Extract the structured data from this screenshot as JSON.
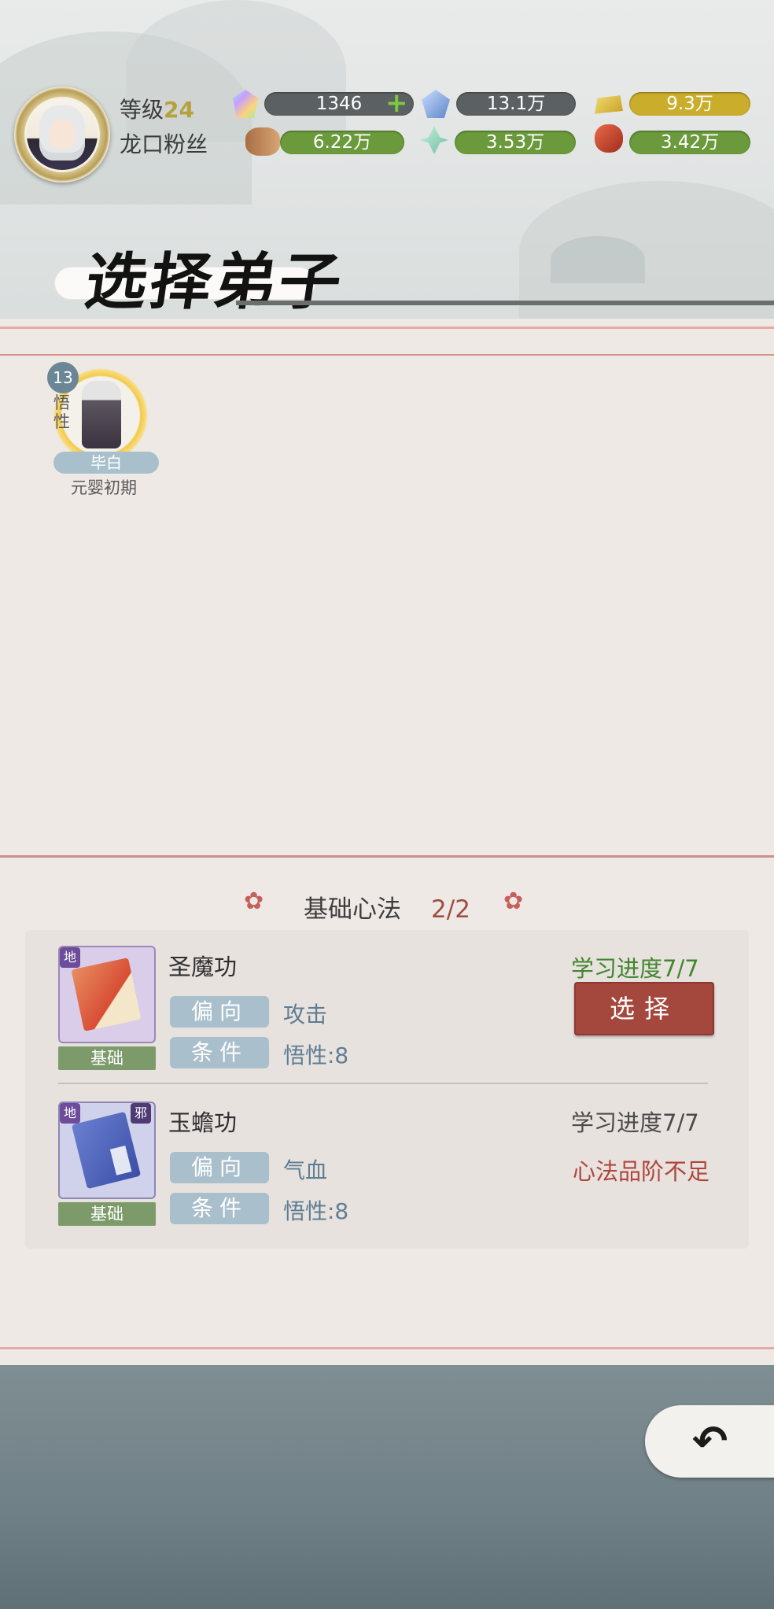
{
  "player": {
    "level_label": "等级",
    "level": "24",
    "fans_label": "龙口粉丝"
  },
  "resources": [
    {
      "name": "spirit-crystal",
      "value": "1346",
      "has_plus": true
    },
    {
      "name": "blue-ore",
      "value": "13.1万"
    },
    {
      "name": "gold-ingot",
      "value": "9.3万"
    },
    {
      "name": "wood",
      "value": "6.22万"
    },
    {
      "name": "herb",
      "value": "3.53万"
    },
    {
      "name": "meat",
      "value": "3.42万"
    }
  ],
  "page": {
    "title": "选择弟子"
  },
  "disciple": {
    "aptitude_value": "13",
    "aptitude_label": "悟性",
    "name": "毕白",
    "realm": "元婴初期"
  },
  "skills_section": {
    "title": "基础心法",
    "count": "2/2",
    "items": [
      {
        "grade": "地",
        "name": "圣魔功",
        "tag": "基础",
        "bias_label": "偏向",
        "bias_value": "攻击",
        "cond_label": "条件",
        "cond_value": "悟性:8",
        "progress": "学习进度7/7",
        "action_label": "选择"
      },
      {
        "grade": "地",
        "extra_grade": "邪",
        "name": "玉蟾功",
        "tag": "基础",
        "bias_label": "偏向",
        "bias_value": "气血",
        "cond_label": "条件",
        "cond_value": "悟性:8",
        "progress": "学习进度7/7",
        "status": "心法品阶不足"
      }
    ]
  },
  "colors": {
    "accent_red": "#a4473d",
    "progress_green": "#41862f",
    "chip_blue": "#a9bfcc"
  }
}
